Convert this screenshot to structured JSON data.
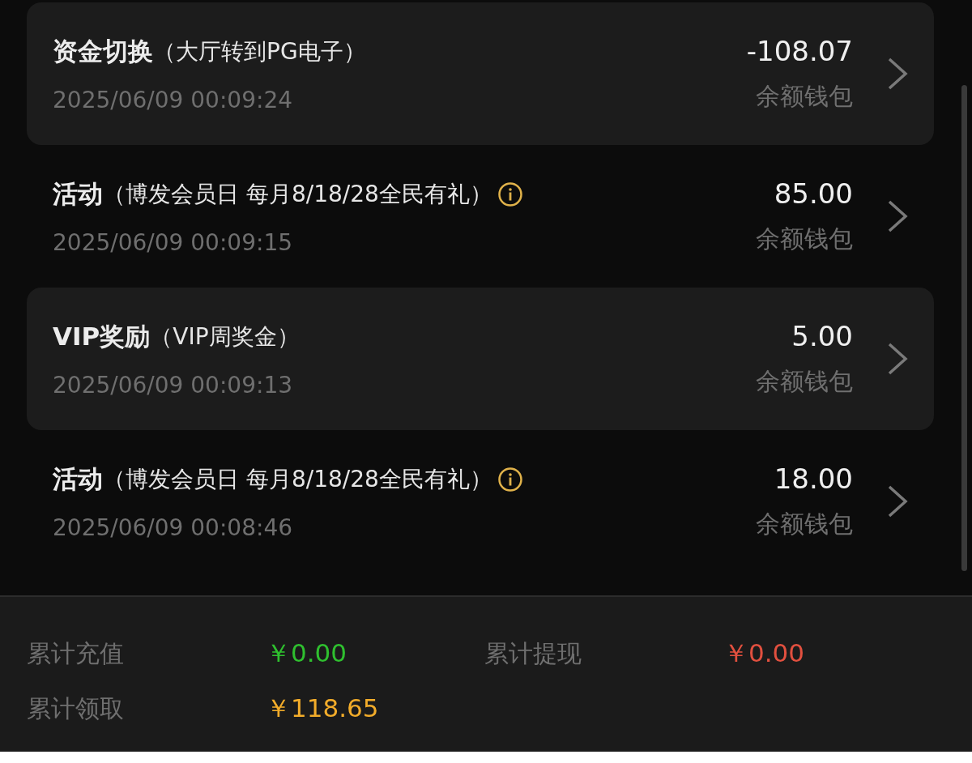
{
  "records": [
    {
      "title": "资金切换",
      "detail": "（大厅转到PG电子）",
      "info": false,
      "shaded": true,
      "time": "2025/06/09 00:09:24",
      "amount": "-108.07",
      "wallet": "余额钱包"
    },
    {
      "title": "活动",
      "detail": "（博发会员日 每月8/18/28全民有礼）",
      "info": true,
      "shaded": false,
      "time": "2025/06/09 00:09:15",
      "amount": "85.00",
      "wallet": "余额钱包"
    },
    {
      "title": "VIP奖励",
      "detail": "（VIP周奖金）",
      "info": false,
      "shaded": true,
      "time": "2025/06/09 00:09:13",
      "amount": "5.00",
      "wallet": "余额钱包"
    },
    {
      "title": "活动",
      "detail": "（博发会员日 每月8/18/28全民有礼）",
      "info": true,
      "shaded": false,
      "time": "2025/06/09 00:08:46",
      "amount": "18.00",
      "wallet": "余额钱包"
    }
  ],
  "summary": [
    {
      "label": "累计充值",
      "value": "￥0.00",
      "color": "#2fc02f"
    },
    {
      "label": "累计提现",
      "value": "￥0.00",
      "color": "#e2503f"
    },
    {
      "label": "累计领取",
      "value": "￥118.65",
      "color": "#f2ac2a"
    }
  ]
}
